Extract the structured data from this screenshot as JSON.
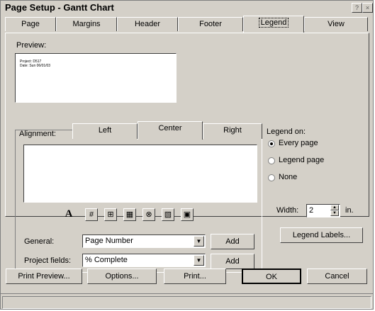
{
  "window": {
    "title": "Page Setup - Gantt Chart",
    "help_glyph": "?",
    "close_glyph": "×"
  },
  "tabs": [
    "Page",
    "Margins",
    "Header",
    "Footer",
    "Legend",
    "View"
  ],
  "active_tab": "Legend",
  "preview": {
    "label": "Preview:",
    "lines": [
      "Project: D517",
      "Date: Sun 06/01/03"
    ]
  },
  "alignment": {
    "label": "Alignment:",
    "tabs": [
      "Left",
      "Center",
      "Right"
    ],
    "active": "Center",
    "text": ""
  },
  "toolbar_icons": [
    {
      "name": "font-format-icon",
      "glyph": "A"
    },
    {
      "name": "page-number-icon",
      "glyph": "#"
    },
    {
      "name": "total-pages-icon",
      "glyph": "⊞"
    },
    {
      "name": "date-icon",
      "glyph": "▦"
    },
    {
      "name": "time-icon",
      "glyph": "⊗"
    },
    {
      "name": "file-name-icon",
      "glyph": "▧"
    },
    {
      "name": "insert-picture-icon",
      "glyph": "▣"
    }
  ],
  "fields": {
    "general": {
      "label": "General:",
      "value": "Page Number",
      "add_label": "Add"
    },
    "project": {
      "label": "Project fields:",
      "value": "% Complete",
      "add_label": "Add"
    }
  },
  "legend_on": {
    "label": "Legend on:",
    "options": [
      "Every page",
      "Legend page",
      "None"
    ],
    "selected": "Every page"
  },
  "width": {
    "label": "Width:",
    "value": "2",
    "unit": "in."
  },
  "legend_labels_button": "Legend Labels...",
  "buttons": {
    "print_preview": "Print Preview...",
    "options": "Options...",
    "print": "Print...",
    "ok": "OK",
    "cancel": "Cancel"
  }
}
